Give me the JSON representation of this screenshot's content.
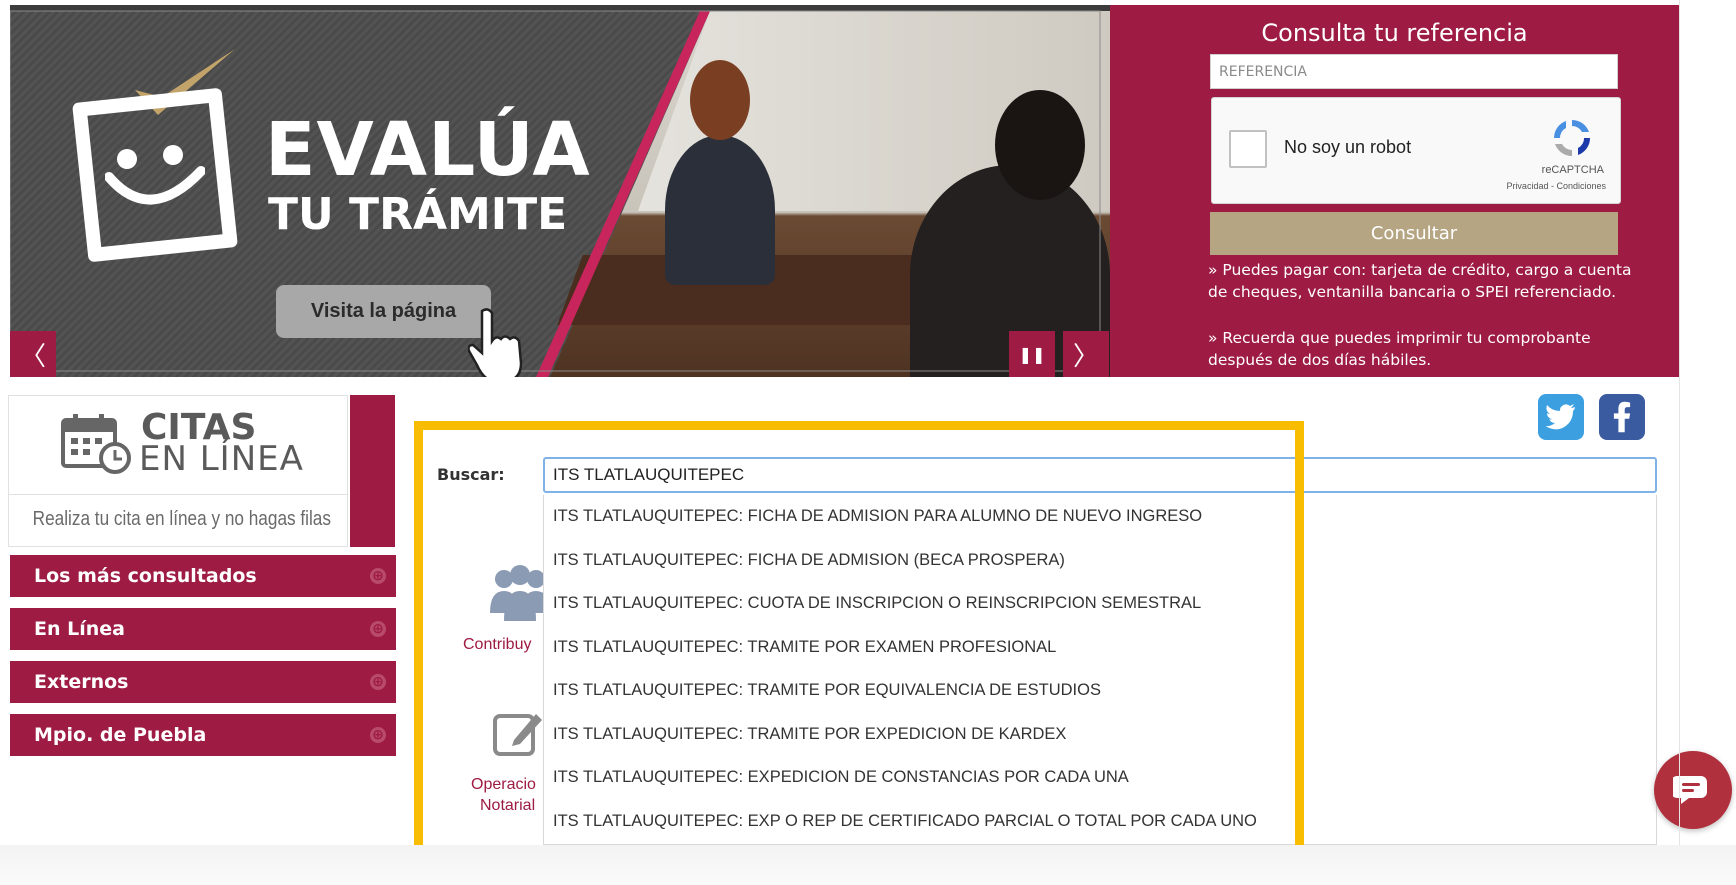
{
  "banner": {
    "title_line1": "EVALÚA",
    "title_line2": "TU TRÁMITE",
    "visit_button": "Visita la página",
    "prev_symbol": "〈",
    "next_symbol": "〉",
    "pause_symbol": "❚❚"
  },
  "consulta": {
    "title": "Consulta tu referencia",
    "reference_placeholder": "REFERENCIA",
    "recaptcha_label": "No soy un robot",
    "recaptcha_brand": "reCAPTCHA",
    "recaptcha_links": "Privacidad - Condiciones",
    "consultar_button": "Consultar",
    "note1": "» Puedes pagar con: tarjeta de crédito, cargo a cuenta de cheques, ventanilla bancaria o SPEI referenciado.",
    "note2": "» Recuerda que puedes imprimir tu comprobante después de dos días hábiles."
  },
  "citas": {
    "word1": "CITAS",
    "word2": "EN LÍNEA",
    "tagline": "Realiza tu cita en línea y no hagas filas"
  },
  "menu": {
    "items": [
      {
        "label": "Los más consultados"
      },
      {
        "label": "En Línea"
      },
      {
        "label": "Externos"
      },
      {
        "label": "Mpio. de Puebla"
      }
    ],
    "expand_symbol": "⊕"
  },
  "search": {
    "label": "Buscar:",
    "value": "ITS TLATLAUQUITEPEC",
    "suggestions": [
      "ITS TLATLAUQUITEPEC: FICHA DE ADMISION PARA ALUMNO DE NUEVO INGRESO",
      "ITS TLATLAUQUITEPEC: FICHA DE ADMISION (BECA PROSPERA)",
      "ITS TLATLAUQUITEPEC: CUOTA DE INSCRIPCION O REINSCRIPCION SEMESTRAL",
      "ITS TLATLAUQUITEPEC: TRAMITE POR EXAMEN PROFESIONAL",
      "ITS TLATLAUQUITEPEC: TRAMITE POR EQUIVALENCIA DE ESTUDIOS",
      "ITS TLATLAUQUITEPEC: TRAMITE POR EXPEDICION DE KARDEX",
      "ITS TLATLAUQUITEPEC: EXPEDICION DE CONSTANCIAS POR CADA UNA",
      "ITS TLATLAUQUITEPEC: EXP O REP DE CERTIFICADO PARCIAL O TOTAL POR CADA UNO"
    ]
  },
  "behind": {
    "contrib_label": "Contribuy",
    "notarial_label1": "Operacio",
    "notarial_label2": "Notarial"
  },
  "icons": {
    "twitter": "twitter-icon",
    "facebook": "facebook-icon",
    "chat": "chat-icon",
    "calendar": "calendar-icon",
    "users": "users-icon",
    "edit": "edit-icon"
  },
  "colors": {
    "brand": "#9e1b43",
    "highlight": "#f8bd00",
    "consultar": "#b6a583"
  }
}
